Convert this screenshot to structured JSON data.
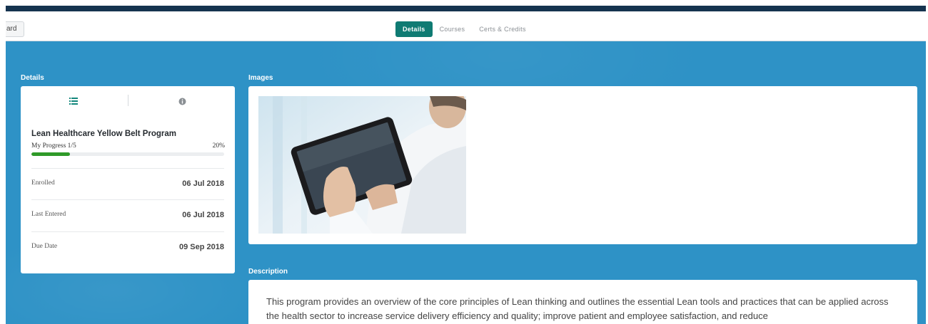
{
  "toolbar": {
    "back_label": "ard"
  },
  "tabs": [
    {
      "label": "Details",
      "active": true
    },
    {
      "label": "Courses",
      "active": false
    },
    {
      "label": "Certs & Credits",
      "active": false
    }
  ],
  "sections": {
    "details": "Details",
    "images": "Images",
    "description": "Description"
  },
  "details_card": {
    "icons": [
      "list-icon",
      "info-icon"
    ],
    "program_title": "Lean Healthcare Yellow Belt Program",
    "progress_label": "My Progress 1/5",
    "progress_percent_text": "20%",
    "progress_value": 0.2,
    "rows": [
      {
        "label": "Enrolled",
        "value": "06 Jul 2018"
      },
      {
        "label": "Last Entered",
        "value": "06 Jul 2018"
      },
      {
        "label": "Due Date",
        "value": "09 Sep 2018"
      }
    ]
  },
  "description": {
    "text": "This program provides an overview of the core principles of Lean thinking and outlines the essential Lean tools and practices that can be applied across the health sector to increase service delivery efficiency and quality; improve patient and employee satisfaction, and reduce"
  },
  "colors": {
    "top_strip": "#15334f",
    "background_blue": "#2e92c6",
    "active_tab": "#0f7b73",
    "progress_fill": "#2f9a28"
  }
}
